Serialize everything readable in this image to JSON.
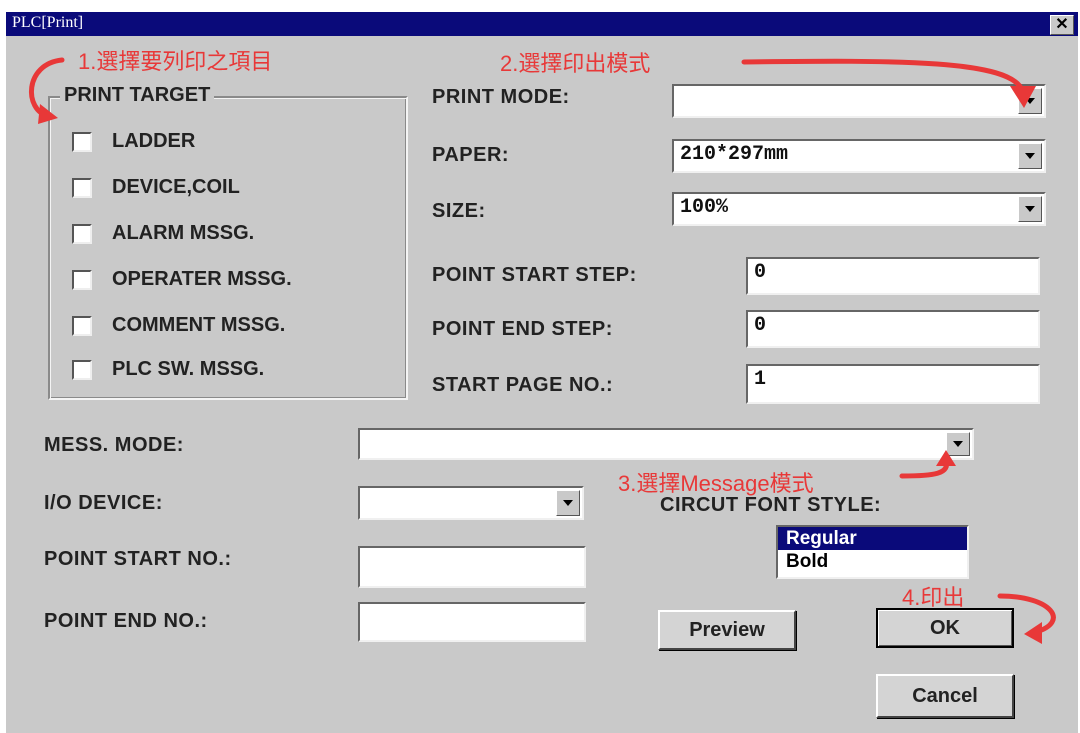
{
  "window": {
    "title": "PLC[Print]",
    "close_glyph": "✕"
  },
  "annotations": {
    "step1": "1.選擇要列印之項目",
    "step2": "2.選擇印出模式",
    "step3": "3.選擇Message模式",
    "step4": "4.印出",
    "color": "#e83838"
  },
  "print_target": {
    "title": "PRINT TARGET",
    "items": [
      "LADDER",
      "DEVICE,COIL",
      "ALARM MSSG.",
      "OPERATER MSSG.",
      "COMMENT MSSG.",
      "PLC SW. MSSG."
    ]
  },
  "print_mode": {
    "label": "PRINT MODE:",
    "value": ""
  },
  "paper": {
    "label": "PAPER:",
    "value": "210*297mm"
  },
  "size": {
    "label": "SIZE:",
    "value": "100%"
  },
  "point_start_step": {
    "label": "POINT START STEP:",
    "value": "0"
  },
  "point_end_step": {
    "label": "POINT END STEP:",
    "value": "0"
  },
  "start_page_no": {
    "label": "START PAGE NO.:",
    "value": "1"
  },
  "mess_mode": {
    "label": "MESS. MODE:",
    "value": ""
  },
  "io_device": {
    "label": "I/O DEVICE:",
    "value": ""
  },
  "point_start_no": {
    "label": "POINT START NO.:",
    "value": ""
  },
  "point_end_no": {
    "label": "POINT END NO.:",
    "value": ""
  },
  "circuit_font": {
    "label": "CIRCUT FONT STYLE:",
    "options": [
      "Regular",
      "Bold"
    ],
    "selected": "Regular"
  },
  "buttons": {
    "preview": "Preview",
    "ok": "OK",
    "cancel": "Cancel"
  },
  "colors": {
    "titlebar": "#0a0a7a",
    "dialog_bg": "#c9c9c9",
    "selection": "#0a0a7a"
  }
}
